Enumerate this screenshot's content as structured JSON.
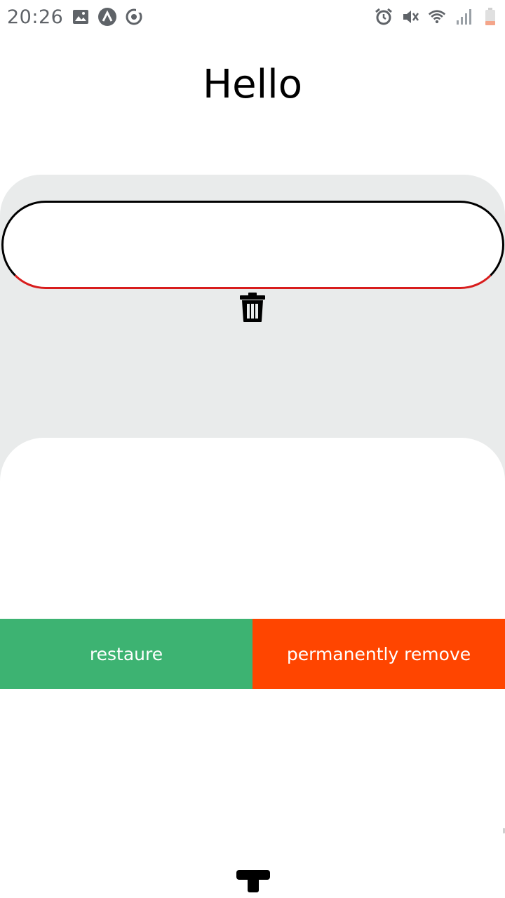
{
  "status_bar": {
    "time": "20:26",
    "left_icons": [
      "image-icon",
      "app-a-icon",
      "sync-icon"
    ],
    "right_icons": [
      "alarm-icon",
      "mute-icon",
      "wifi-icon",
      "signal-icon",
      "battery-icon"
    ]
  },
  "title": "Hello",
  "input": {
    "value": ""
  },
  "actions": {
    "restore_label": "restaure",
    "remove_label": "permanently remove"
  },
  "colors": {
    "card": "#e9ebeb",
    "restore": "#3db372",
    "remove": "#ff4500",
    "input_border": "#000000",
    "input_underline": "#d81d1d"
  }
}
